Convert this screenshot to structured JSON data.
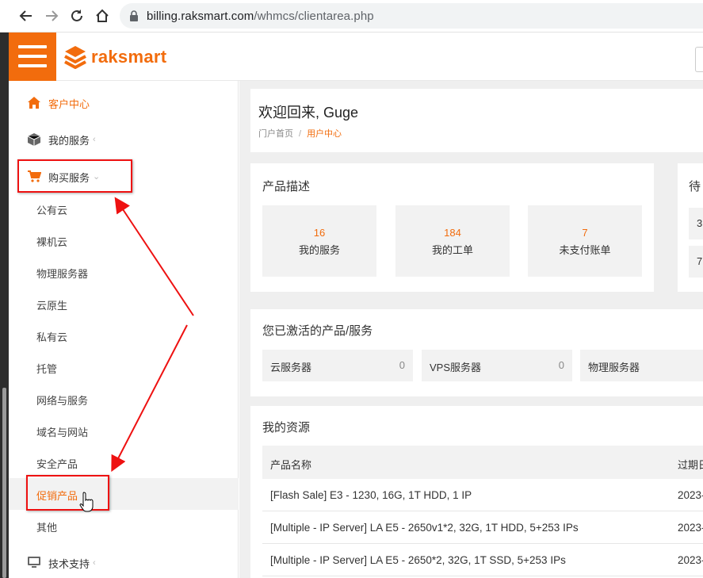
{
  "browser": {
    "url_domain": "billing.raksmart.com",
    "url_path": "/whmcs/clientarea.php"
  },
  "header": {
    "logo_text": "raksmart"
  },
  "sidebar": {
    "items": [
      {
        "label": "客户中心",
        "icon": "home-icon"
      },
      {
        "label": "我的服务",
        "icon": "box-icon"
      },
      {
        "label": "购买服务",
        "icon": "cart-icon"
      },
      {
        "label": "技术支持",
        "icon": "monitor-icon"
      }
    ],
    "sub_items": [
      "公有云",
      "裸机云",
      "物理服务器",
      "云原生",
      "私有云",
      "托管",
      "网络与服务",
      "域名与网站",
      "安全产品",
      "促销产品",
      "其他"
    ]
  },
  "main": {
    "welcome": "欢迎回来, Guge",
    "breadcrumb": {
      "home": "门户首页",
      "separator": "/",
      "current": "用户中心"
    },
    "overview": {
      "title": "产品描述",
      "stats": [
        {
          "value": "16",
          "label": "我的服务"
        },
        {
          "value": "184",
          "label": "我的工单"
        },
        {
          "value": "7",
          "label": "未支付账单"
        }
      ]
    },
    "pending": {
      "title_partial": "待",
      "values": [
        "3",
        "7"
      ]
    },
    "active": {
      "title": "您已激活的产品/服务",
      "boxes": [
        {
          "label": "云服务器",
          "count": "0"
        },
        {
          "label": "VPS服务器",
          "count": "0"
        },
        {
          "label": "物理服务器",
          "count": ""
        }
      ]
    },
    "resources": {
      "title": "我的资源",
      "col_name": "产品名称",
      "col_expiry": "过期日",
      "rows": [
        {
          "name": "[Flash Sale] E3 - 1230, 16G, 1T HDD, 1 IP",
          "expiry": "2023-"
        },
        {
          "name": "[Multiple - IP Server] LA E5 - 2650v1*2, 32G, 1T HDD, 5+253 IPs",
          "expiry": "2023-"
        },
        {
          "name": "[Multiple - IP Server] LA E5 - 2650*2, 32G, 1T SSD, 5+253 IPs",
          "expiry": "2023-"
        }
      ]
    }
  },
  "colors": {
    "accent": "#f26c0d",
    "annotation": "#e11111"
  }
}
